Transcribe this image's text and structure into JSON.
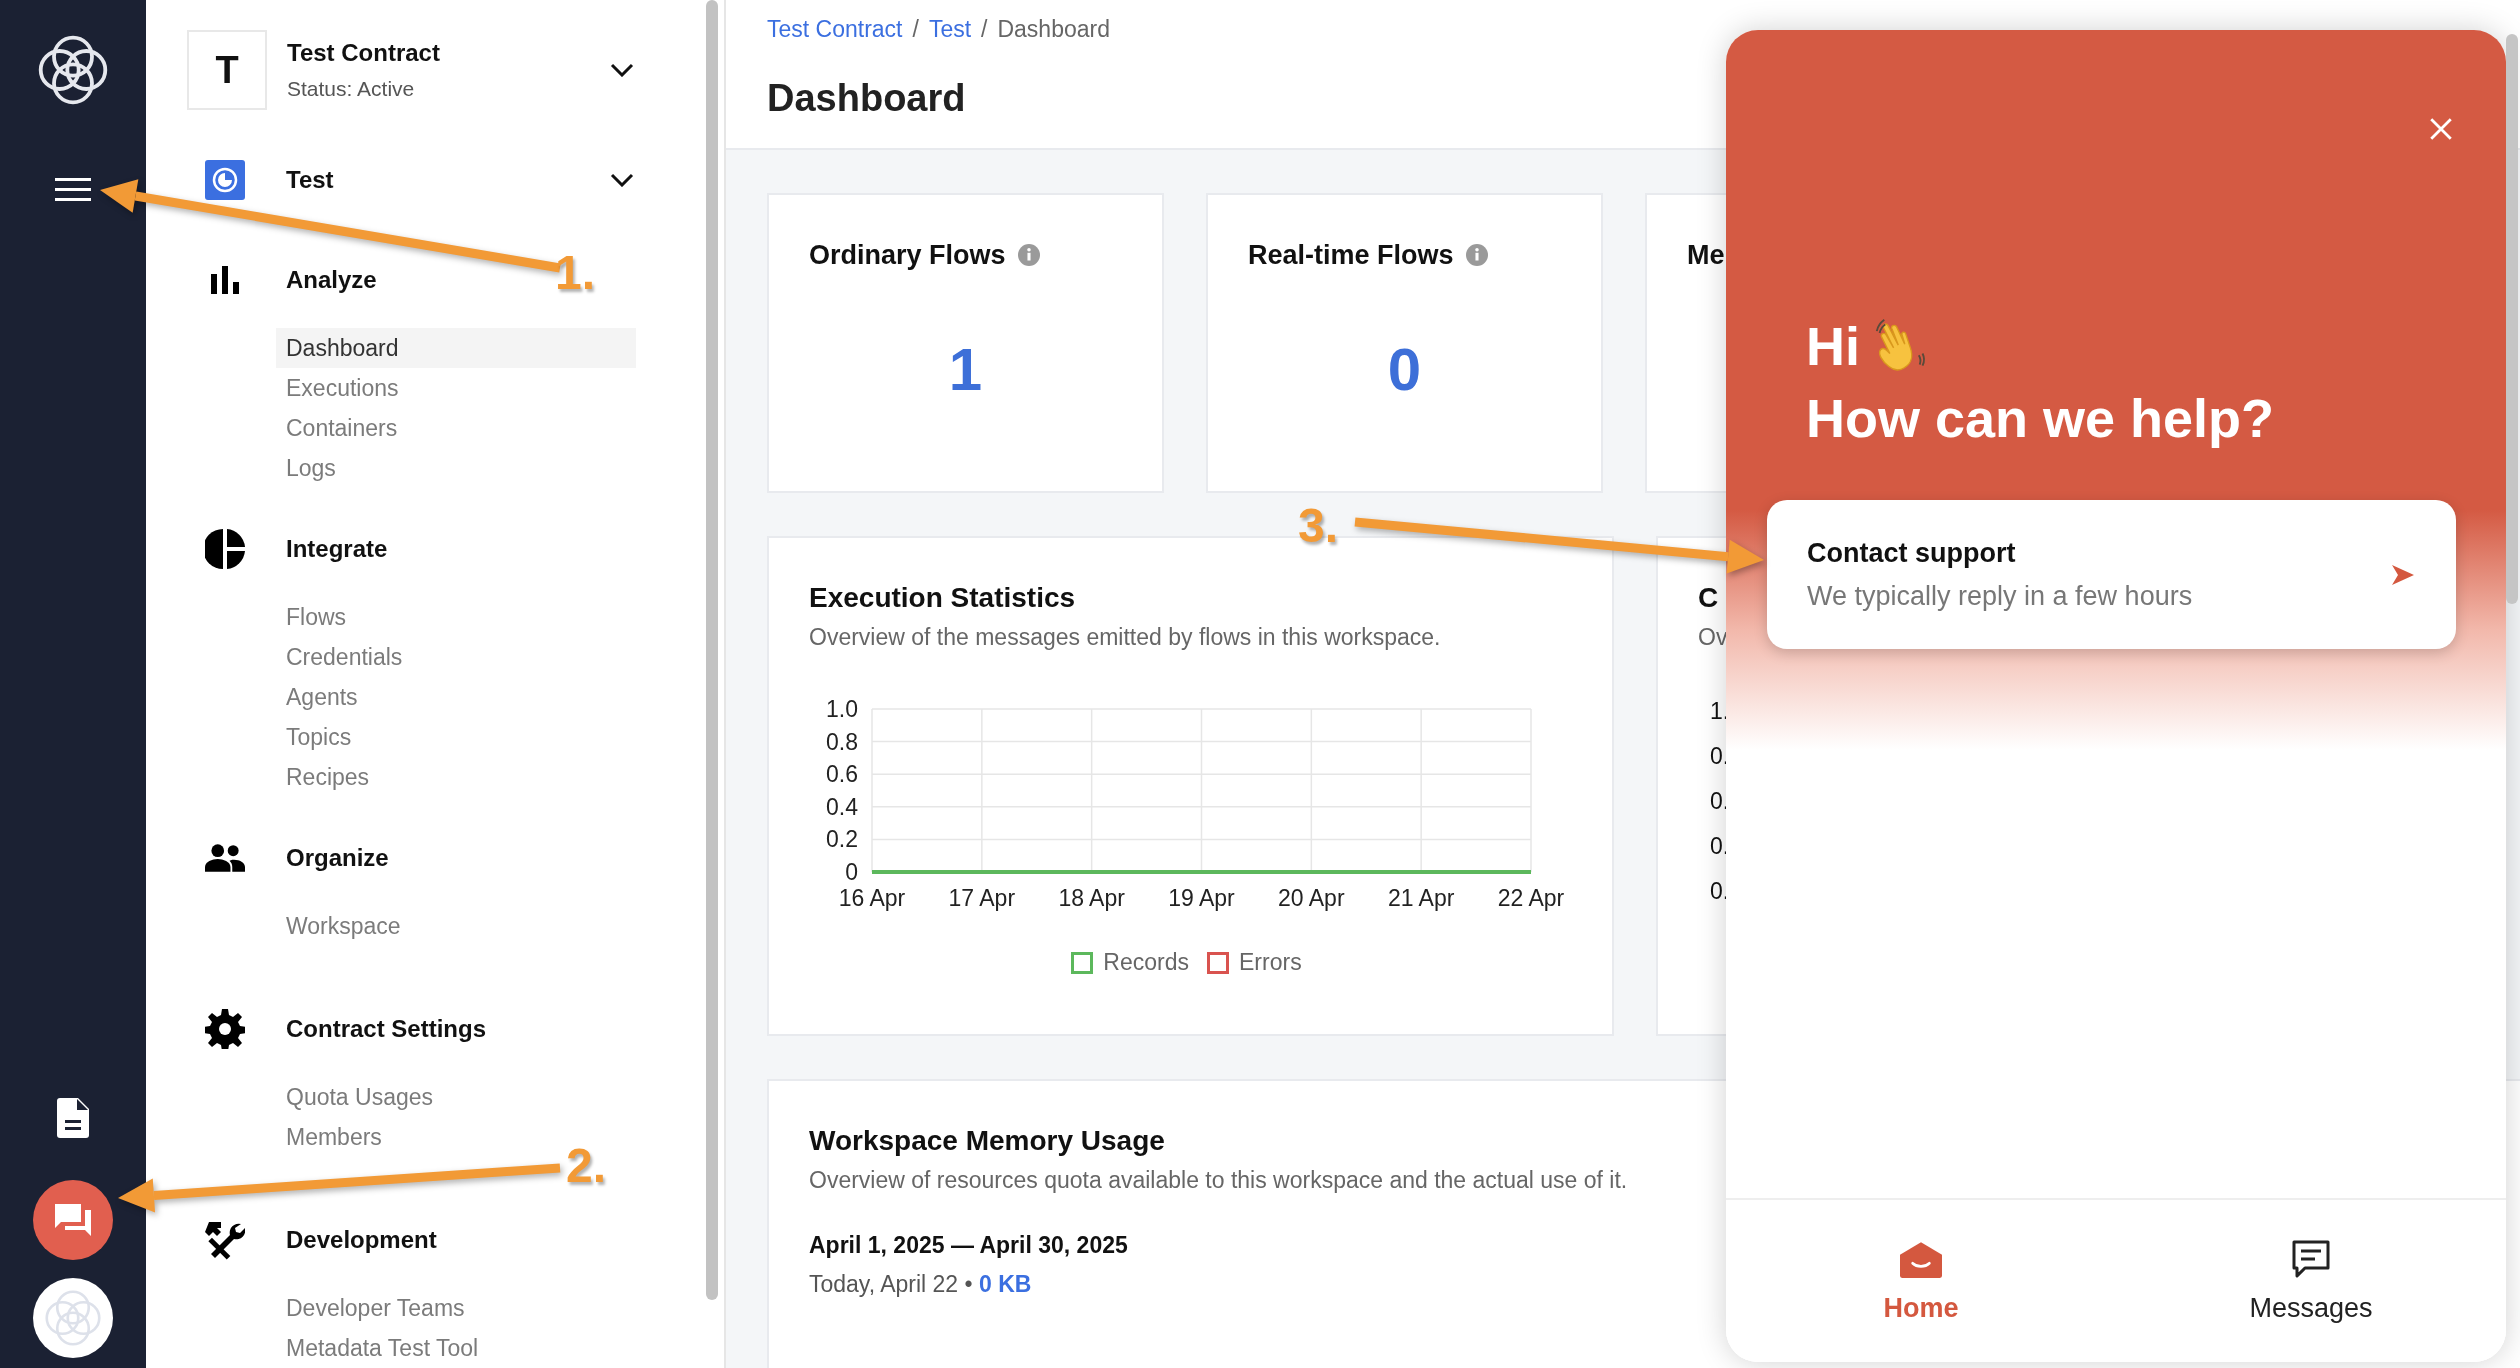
{
  "contract": {
    "initial": "T",
    "name": "Test Contract",
    "status": "Status: Active"
  },
  "workspace": {
    "name": "Test"
  },
  "sidebar": {
    "sections": [
      {
        "kind": "analyze",
        "title": "Analyze",
        "items": [
          {
            "label": "Dashboard",
            "selected": true
          },
          {
            "label": "Executions",
            "selected": false
          },
          {
            "label": "Containers",
            "selected": false
          },
          {
            "label": "Logs",
            "selected": false
          }
        ]
      },
      {
        "kind": "integrate",
        "title": "Integrate",
        "items": [
          {
            "label": "Flows",
            "selected": false
          },
          {
            "label": "Credentials",
            "selected": false
          },
          {
            "label": "Agents",
            "selected": false
          },
          {
            "label": "Topics",
            "selected": false
          },
          {
            "label": "Recipes",
            "selected": false
          }
        ]
      },
      {
        "kind": "organize",
        "title": "Organize",
        "items": [
          {
            "label": "Workspace",
            "selected": false
          }
        ]
      },
      {
        "kind": "settings",
        "title": "Contract Settings",
        "items": [
          {
            "label": "Quota Usages",
            "selected": false
          },
          {
            "label": "Members",
            "selected": false
          }
        ]
      },
      {
        "kind": "development",
        "title": "Development",
        "items": [
          {
            "label": "Developer Teams",
            "selected": false
          },
          {
            "label": "Metadata Test Tool",
            "selected": false
          }
        ]
      }
    ]
  },
  "breadcrumb": [
    {
      "kind": "link",
      "label": "Test Contract"
    },
    {
      "kind": "separator",
      "label": "/"
    },
    {
      "kind": "link",
      "label": "Test"
    },
    {
      "kind": "separator",
      "label": "/"
    },
    {
      "kind": "current",
      "label": "Dashboard"
    }
  ],
  "page_title": "Dashboard",
  "stats": [
    {
      "title": "Ordinary Flows",
      "value": "1",
      "info": true
    },
    {
      "title": "Real-time Flows",
      "value": "0",
      "info": true
    },
    {
      "title": "Me",
      "info": false
    }
  ],
  "execution_statistics": {
    "title": "Execution Statistics",
    "description": "Overview of the messages emitted by flows in this workspace.",
    "chart_data": {
      "type": "line",
      "categories": [
        "16 Apr",
        "17 Apr",
        "18 Apr",
        "19 Apr",
        "20 Apr",
        "21 Apr",
        "22 Apr"
      ],
      "series": [
        {
          "name": "Records",
          "color": "#5cb85c",
          "values": [
            0,
            0,
            0,
            0,
            0,
            0,
            0
          ]
        },
        {
          "name": "Errors",
          "color": "#d9534f",
          "values": [
            null,
            null,
            null,
            null,
            null,
            null,
            null
          ]
        }
      ],
      "grid": true,
      "ylim": [
        0,
        1
      ],
      "yticks": [
        0,
        0.2,
        0.4,
        0.6,
        0.8,
        {
          "value": 1,
          "label": "1.0"
        }
      ]
    }
  },
  "second_chart": {
    "title": "C",
    "description": "Ov",
    "y_labels": [
      "1.",
      "0.",
      "0.",
      "0.",
      "0."
    ]
  },
  "memory_usage": {
    "title": "Workspace Memory Usage",
    "description": "Overview of resources quota available to this workspace and the actual use of it.",
    "period": "April 1, 2025 — April 30, 2025",
    "today": "Today, April 22 • **0 KB**"
  },
  "support_widget": {
    "greeting": "Hi",
    "headline": "How can we help?",
    "contact": {
      "title": "Contact support",
      "subtitle": "We typically reply in a few hours"
    },
    "nav": [
      {
        "kind": "home",
        "label": "Home",
        "selected": true
      },
      {
        "kind": "messages",
        "label": "Messages",
        "selected": false
      }
    ]
  },
  "annotations": [
    {
      "label": "1."
    },
    {
      "label": "2."
    },
    {
      "label": "3."
    }
  ]
}
